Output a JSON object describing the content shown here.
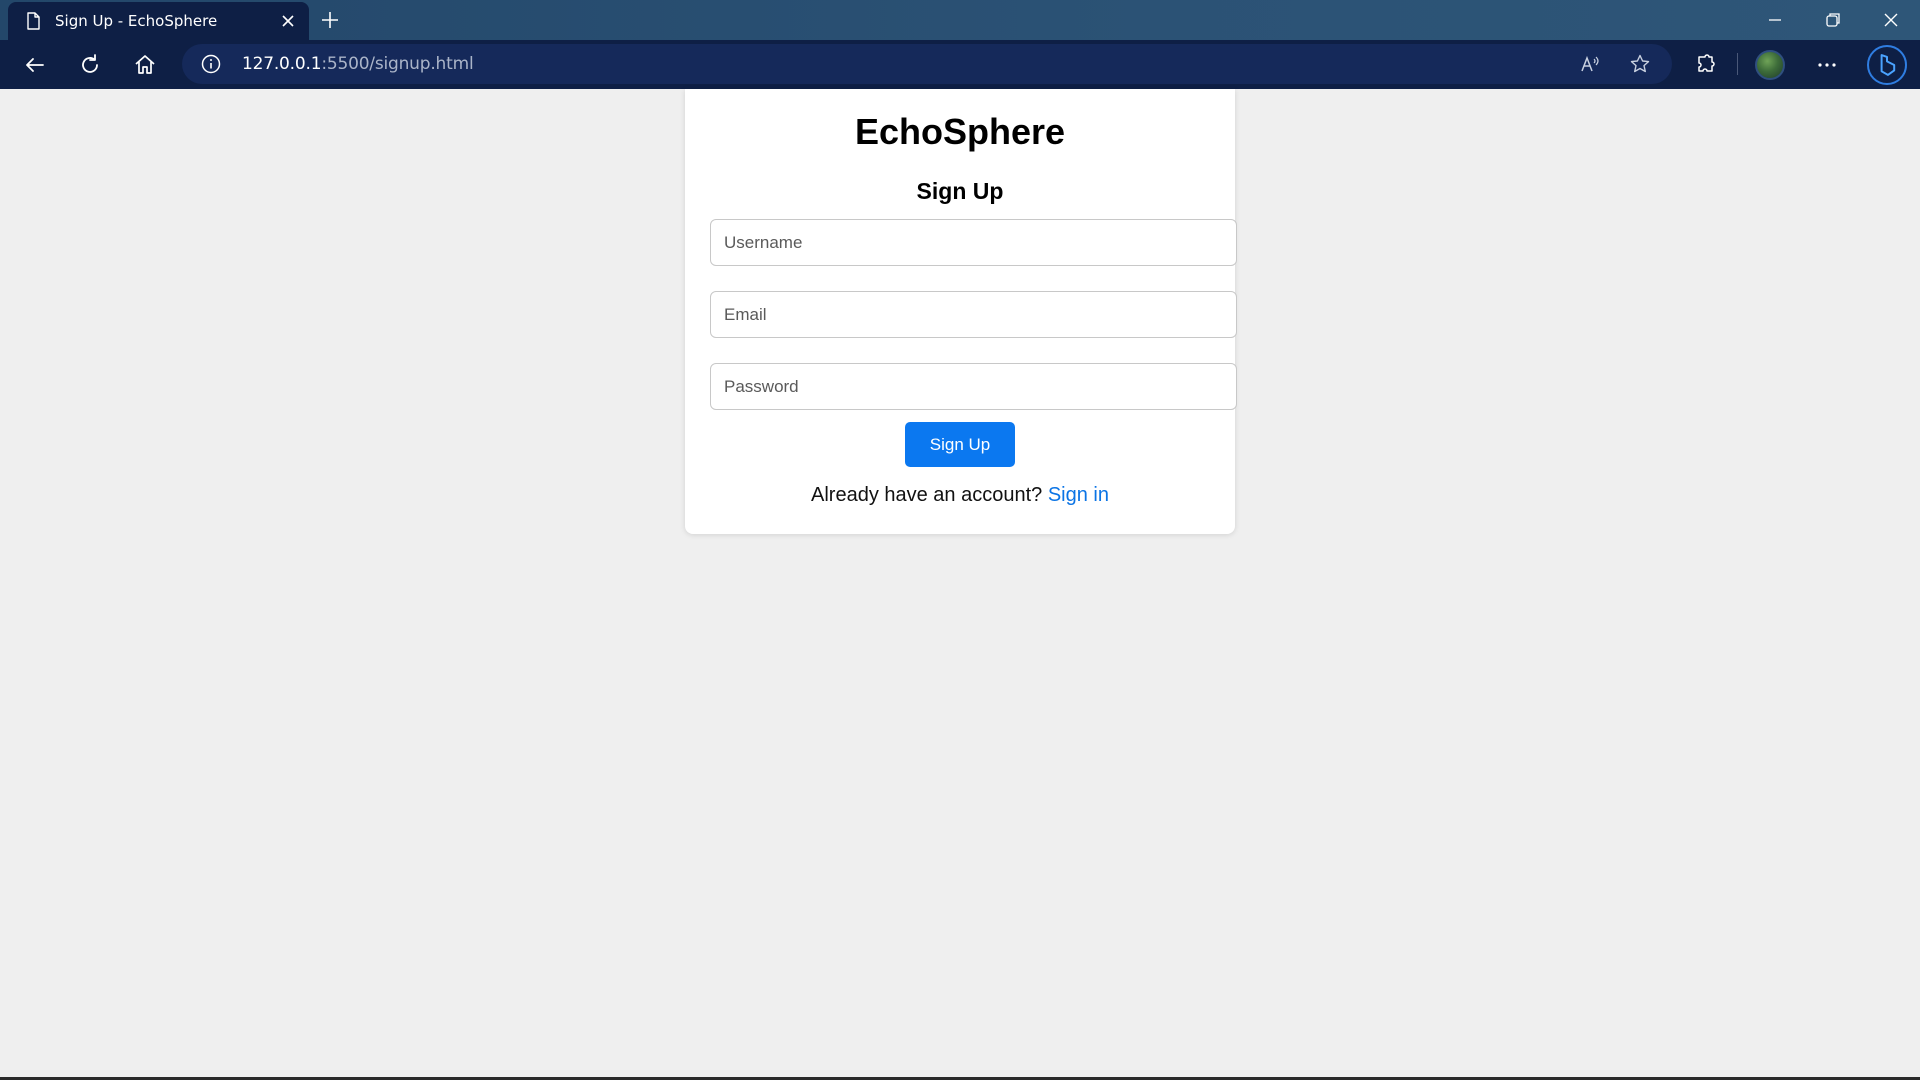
{
  "browser": {
    "tab_title": "Sign Up - EchoSphere",
    "url_host": "127.0.0.1",
    "url_rest": ":5500/signup.html"
  },
  "page": {
    "brand": "EchoSphere",
    "heading": "Sign Up",
    "fields": {
      "username_placeholder": "Username",
      "email_placeholder": "Email",
      "password_placeholder": "Password"
    },
    "submit_label": "Sign Up",
    "footer_text": "Already have an account?",
    "signin_link": "Sign in"
  },
  "colors": {
    "accent": "#0b78f0",
    "link": "#0b74e5",
    "page_bg": "#efefef",
    "toolbar_bg": "#0e1f45"
  }
}
